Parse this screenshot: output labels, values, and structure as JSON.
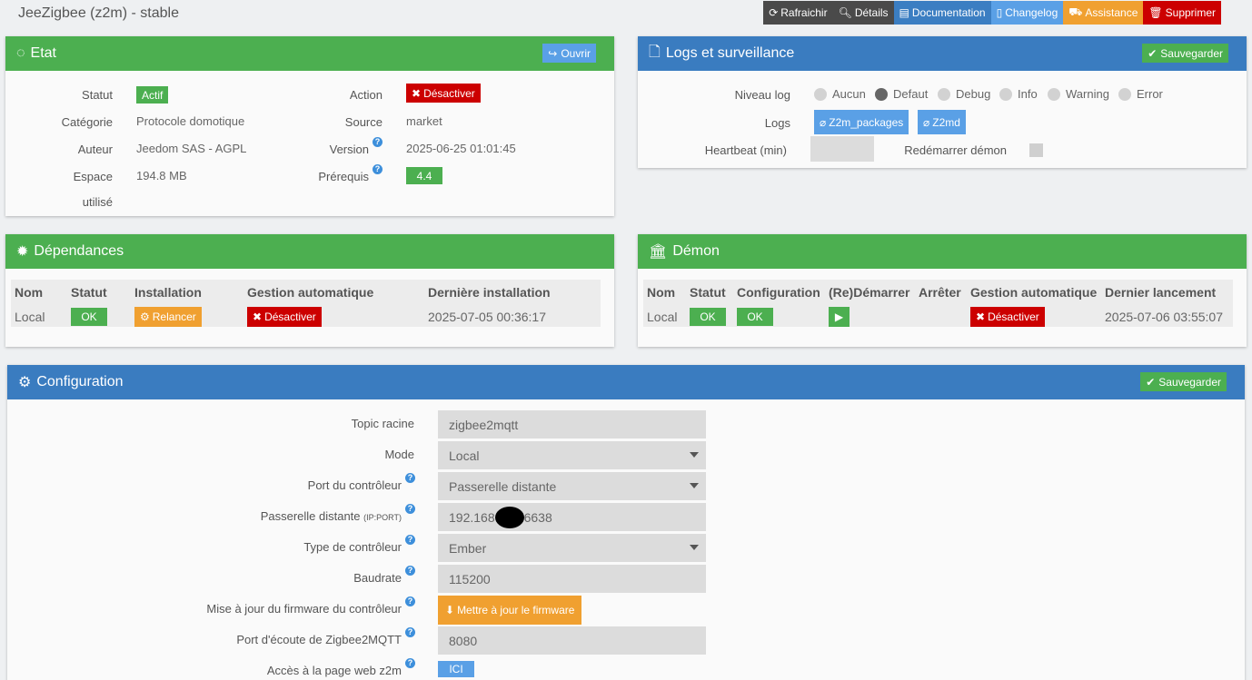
{
  "page": {
    "title": "JeeZigbee (z2m) - stable"
  },
  "topbar": {
    "refresh": "Rafraichir",
    "details": "Détails",
    "documentation": "Documentation",
    "changelog": "Changelog",
    "assistance": "Assistance",
    "delete": "Supprimer"
  },
  "etat": {
    "title": "Etat",
    "open_btn": "Ouvrir",
    "statut_label": "Statut",
    "statut_value": "Actif",
    "categorie_label": "Catégorie",
    "categorie_value": "Protocole domotique",
    "auteur_label": "Auteur",
    "auteur_value": "Jeedom SAS - AGPL",
    "espace_label_1": "Espace",
    "espace_label_2": "utilisé",
    "espace_value": "194.8 MB",
    "action_label": "Action",
    "action_btn": "Désactiver",
    "source_label": "Source",
    "source_value": "market",
    "version_label": "Version",
    "version_value": "2025-06-25 01:01:45",
    "prerequis_label": "Prérequis",
    "prerequis_value": "4.4"
  },
  "logs": {
    "title": "Logs et surveillance",
    "save_btn": "Sauvegarder",
    "niveau_label": "Niveau log",
    "levels": [
      "Aucun",
      "Defaut",
      "Debug",
      "Info",
      "Warning",
      "Error"
    ],
    "selected_level": "Defaut",
    "logs_label": "Logs",
    "log_btn_1": "Z2m_packages",
    "log_btn_2": "Z2md",
    "heartbeat_label": "Heartbeat (min)",
    "heartbeat_value": "",
    "restart_label": "Redémarrer démon"
  },
  "deps": {
    "title": "Dépendances",
    "headers": [
      "Nom",
      "Statut",
      "Installation",
      "Gestion automatique",
      "Dernière installation"
    ],
    "row": {
      "nom": "Local",
      "statut": "OK",
      "installation": "Relancer",
      "gestion": "Désactiver",
      "derniere": "2025-07-05 00:36:17"
    }
  },
  "demon": {
    "title": "Démon",
    "headers": [
      "Nom",
      "Statut",
      "Configuration",
      "(Re)Démarrer",
      "Arrêter",
      "Gestion automatique",
      "Dernier lancement"
    ],
    "row": {
      "nom": "Local",
      "statut": "OK",
      "configuration": "OK",
      "gestion": "Désactiver",
      "dernier": "2025-07-06 03:55:07"
    }
  },
  "config": {
    "title": "Configuration",
    "save_btn": "Sauvegarder",
    "topic_label": "Topic racine",
    "topic_value": "zigbee2mqtt",
    "mode_label": "Mode",
    "mode_value": "Local",
    "port_label": "Port du contrôleur",
    "port_value": "Passerelle distante",
    "passerelle_label": "Passerelle distante",
    "passerelle_sub": "(IP:PORT)",
    "passerelle_value_a": "192.168",
    "passerelle_value_b": "6638",
    "type_label": "Type de contrôleur",
    "type_value": "Ember",
    "baudrate_label": "Baudrate",
    "baudrate_value": "115200",
    "firmware_label": "Mise à jour du firmware du contrôleur",
    "firmware_btn": "Mettre à jour le firmware",
    "listen_label": "Port d'écoute de Zigbee2MQTT",
    "listen_value": "8080",
    "web_label": "Accès à la page web z2m",
    "web_btn": "ICI"
  }
}
